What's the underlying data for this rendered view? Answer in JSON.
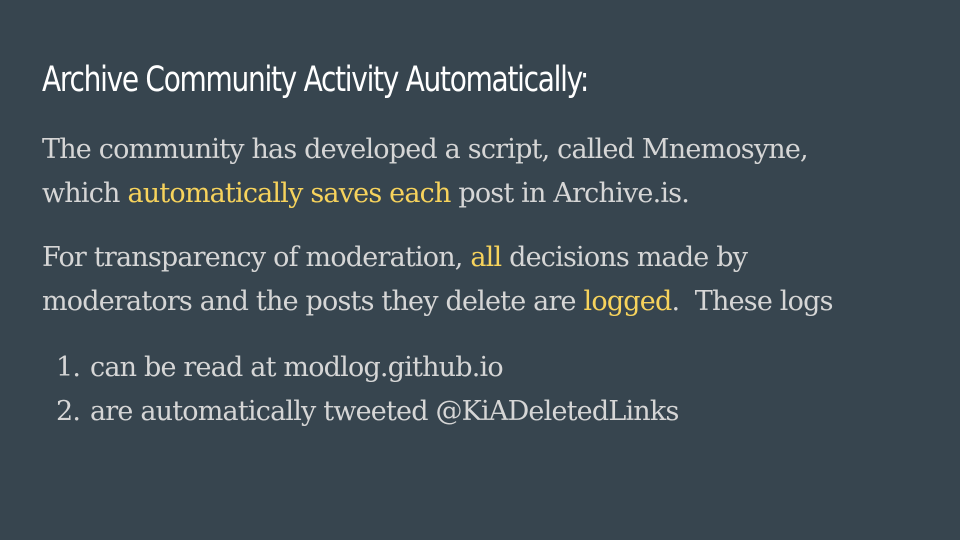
{
  "slide": {
    "title": "Archive Community Activity Automatically:",
    "paragraph1": {
      "line1": "The community has developed a script, called Mnemosyne,",
      "line2_before": "which ",
      "line2_highlight": "automatically saves each",
      "line2_after": " post in Archive.is."
    },
    "paragraph2": {
      "line1_before": "For transparency of moderation, ",
      "line1_highlight": "all",
      "line1_after": " decisions made by",
      "line2_before": "moderators and the posts they delete are ",
      "line2_highlight": "logged",
      "line2_after": ".  These logs"
    },
    "list": [
      {
        "number": "1.",
        "text": "can be read at modlog.github.io"
      },
      {
        "number": "2.",
        "text": "are automatically tweeted @KiADeletedLinks"
      }
    ]
  },
  "colors": {
    "background": "#37454f",
    "title": "#ffffff",
    "body": "#d6d6d6",
    "highlight": "#f7d35c"
  }
}
